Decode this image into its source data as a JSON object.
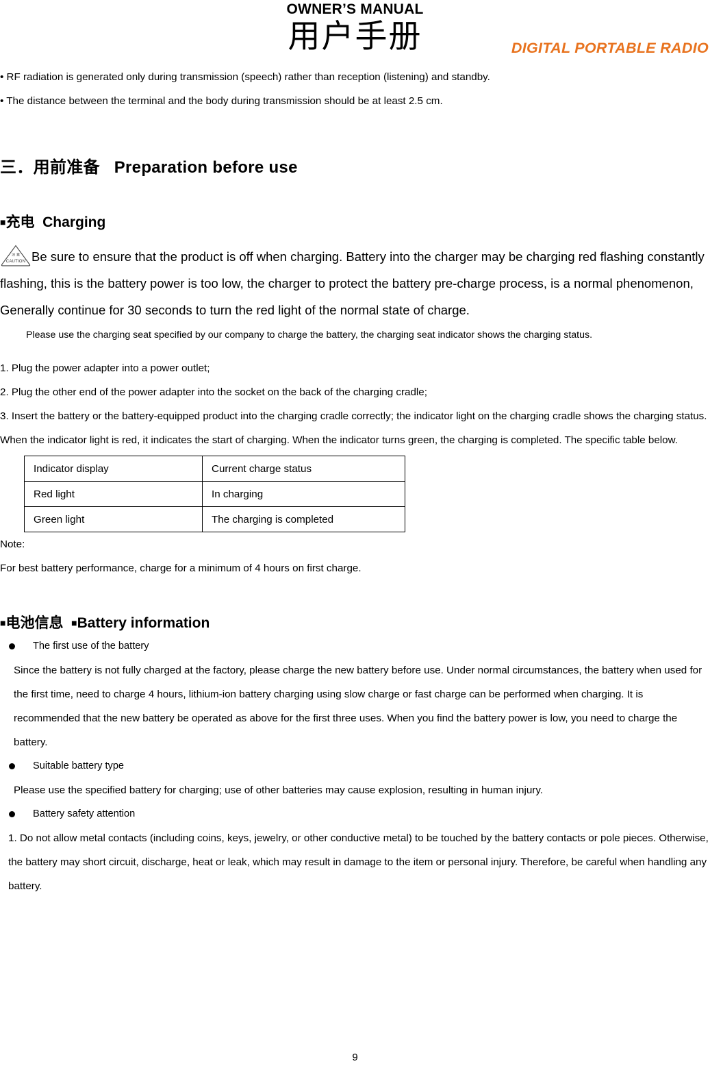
{
  "header": {
    "owners_manual": "OWNER’S MANUAL",
    "chinese_title": "用户手册",
    "product_tagline": "DIGITAL PORTABLE RADIO",
    "tagline_color": "#E8731F"
  },
  "intro_bullets": [
    "• RF radiation is generated only during transmission (speech) rather than reception (listening) and standby.",
    "• The distance between the terminal and the body during transmission should be at least 2.5 cm."
  ],
  "section": {
    "heading_cn": "三．用前准备",
    "heading_en": "Preparation before use"
  },
  "charging": {
    "heading_square": "■",
    "heading_cn": "充电",
    "heading_en": "Charging",
    "caution_icon_label_cn": "注 意",
    "caution_icon_label_en": "CAUTION",
    "caution_text": "Be sure to ensure that the product is off when charging. Battery into the charger may be charging red flashing constantly flashing, this is the battery power is too low, the charger to protect the battery pre-charge process, is a normal phenomenon, Generally continue for 30 seconds to turn the red light of the normal state of charge.",
    "seat_note": "Please use the charging seat specified by our company to charge the battery, the charging seat indicator shows the charging status.",
    "steps": [
      "1. Plug the power adapter into a power outlet;",
      "2. Plug the other end of the power adapter into the socket on the back of the charging cradle;",
      "3. Insert the battery or the battery-equipped product into the charging cradle correctly; the indicator light on the charging cradle shows the charging status. When the indicator light is red, it indicates the start of charging. When the indicator turns green, the charging is completed. The specific table below."
    ],
    "table": {
      "headers": [
        "Indicator display",
        "Current charge status"
      ],
      "rows": [
        [
          "Red light",
          "In charging"
        ],
        [
          "Green light",
          "The charging is completed"
        ]
      ]
    },
    "note_label": "Note:",
    "note_text": "For best battery performance, charge for a minimum of 4 hours on first charge."
  },
  "battery_info": {
    "heading_square_1": "■",
    "heading_cn": "电池信息",
    "heading_square_2": "■",
    "heading_en": "Battery information",
    "items": [
      {
        "bullet_label": "The first use of the battery",
        "body": "Since the battery is not fully charged at the factory, please charge the new battery before use. Under normal circumstances, the battery when used for the first time, need to charge 4 hours, lithium-ion battery charging using slow charge or fast charge can be performed when charging. It is recommended that the new battery be operated as above for the first three uses. When you find the battery power is low, you need to charge the battery."
      },
      {
        "bullet_label": "Suitable battery type",
        "body": "Please use the specified battery for charging; use of other batteries may cause explosion, resulting in human injury."
      },
      {
        "bullet_label": "Battery safety attention",
        "body": "1. Do not allow metal contacts (including coins, keys, jewelry, or other conductive metal) to be touched by the battery contacts or pole pieces. Otherwise, the battery may short circuit, discharge, heat or leak, which may result in damage to the item or personal injury. Therefore, be careful when handling any battery."
      }
    ]
  },
  "footer": {
    "page_number": "9"
  }
}
